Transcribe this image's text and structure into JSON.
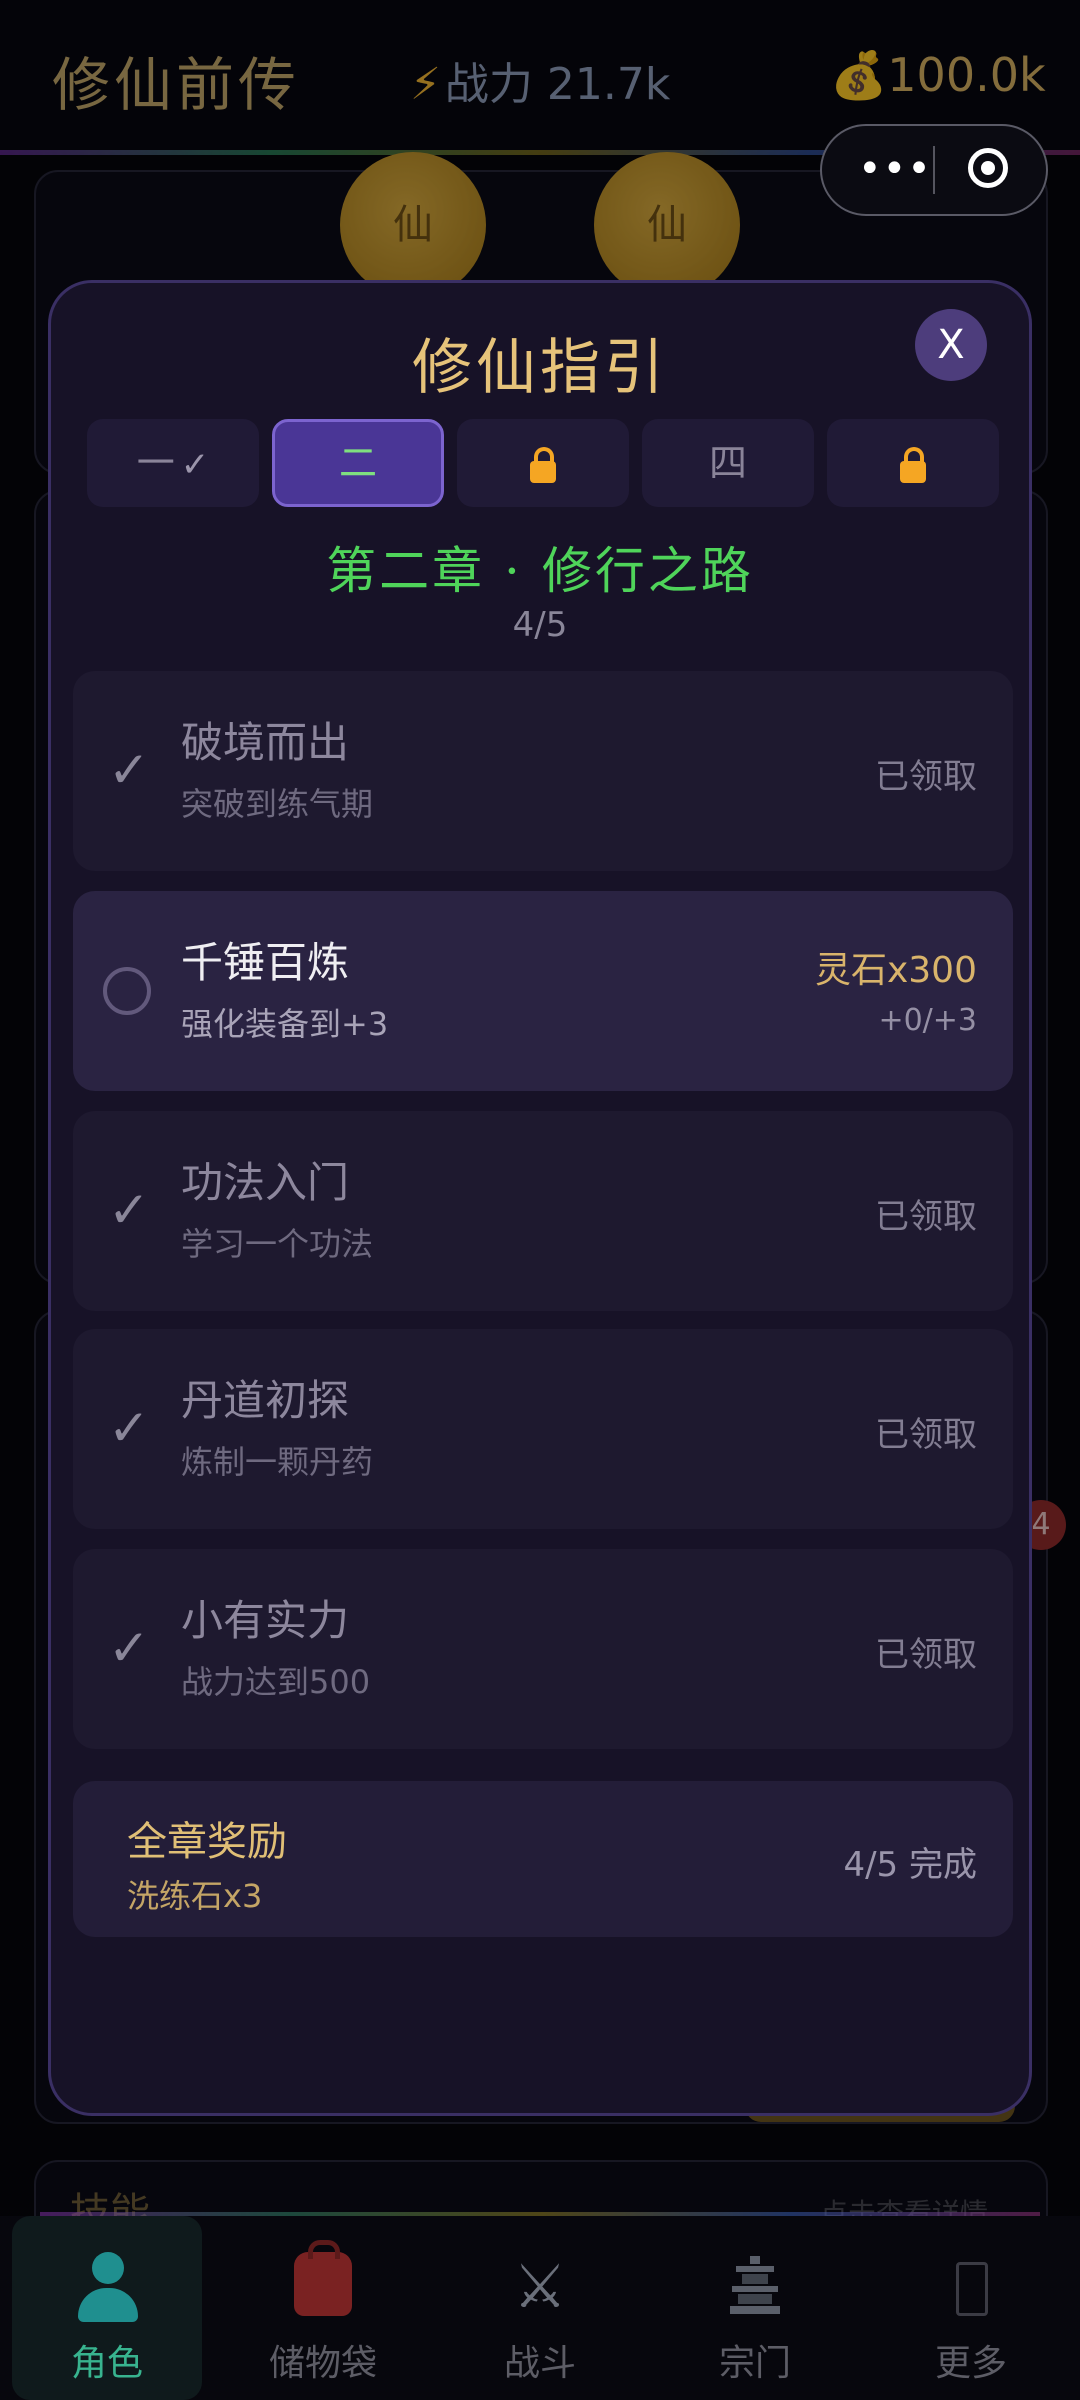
{
  "header": {
    "title": "修仙前传",
    "power_icon": "⚡",
    "power": "战力 21.7k",
    "money_icon": "💰",
    "money": "100.0k",
    "capsule_dots": "•••"
  },
  "background": {
    "orb_char": "仙",
    "badge_count": "4",
    "skill_label": "技能",
    "hint_text": "点击查看详情"
  },
  "modal": {
    "title": "修仙指引",
    "close_label": "X",
    "tabs": [
      {
        "label": "一",
        "state": "completed",
        "check": "✓"
      },
      {
        "label": "二",
        "state": "active"
      },
      {
        "label": "",
        "state": "locked",
        "icon": "lock-icon"
      },
      {
        "label": "四",
        "state": "available"
      },
      {
        "label": "",
        "state": "locked",
        "icon": "lock-icon"
      }
    ],
    "chapter_title": "第二章 · 修行之路",
    "progress": "4/5",
    "check_mark": "✓",
    "quests": [
      {
        "title": "破境而出",
        "desc": "突破到练气期",
        "status": "已领取",
        "done": true
      },
      {
        "title": "千锤百炼",
        "desc": "强化装备到+3",
        "reward": "灵石x300",
        "progress": "+0/+3",
        "done": false
      },
      {
        "title": "功法入门",
        "desc": "学习一个功法",
        "status": "已领取",
        "done": true
      },
      {
        "title": "丹道初探",
        "desc": "炼制一颗丹药",
        "status": "已领取",
        "done": true
      },
      {
        "title": "小有实力",
        "desc": "战力达到500",
        "status": "已领取",
        "done": true
      }
    ],
    "chapter_reward": {
      "title": "全章奖励",
      "item": "洗练石x3",
      "status": "4/5 完成"
    }
  },
  "nav": {
    "items": [
      {
        "label": "角色",
        "icon": "person-icon",
        "active": true
      },
      {
        "label": "储物袋",
        "icon": "backpack-icon"
      },
      {
        "label": "战斗",
        "icon": "crossed-swords-icon",
        "glyph": "⚔"
      },
      {
        "label": "宗门",
        "icon": "pagoda-icon"
      },
      {
        "label": "更多",
        "icon": "more-icon"
      }
    ]
  },
  "colors": {
    "accent_gold": "#e6c37a",
    "chapter_green": "#4fd45a",
    "tab_active": "#4a3696",
    "nav_active": "#38b48f",
    "lock": "#f5a623"
  }
}
